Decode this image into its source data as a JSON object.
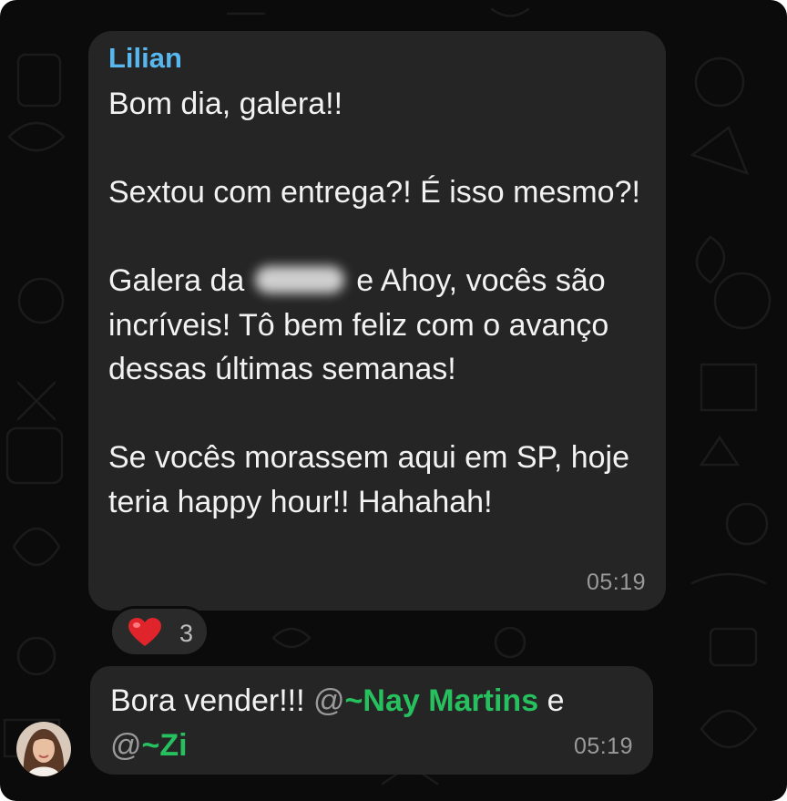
{
  "message1": {
    "sender": "Lilian",
    "line1": "Bom dia, galera!!",
    "line2": "Sextou com entrega?! É isso mesmo?!",
    "line3a": "Galera da",
    "line3b": "e Ahoy, vocês são incríveis! Tô bem feliz com o avanço dessas últimas semanas!",
    "line4": "Se vocês morassem aqui em SP, hoje teria happy hour!! Hahahah!",
    "time": "05:19",
    "reaction": {
      "emoji": "heart",
      "count": "3"
    }
  },
  "message2": {
    "text": "Bora vender!!!",
    "mention1_at": "@",
    "mention1_name": "~Nay Martins",
    "joiner": "e",
    "mention2_at": "@",
    "mention2_name": "~Zi",
    "time": "05:19"
  },
  "colors": {
    "background": "#0b0b0b",
    "bubble": "#252525",
    "sender": "#57b7ee",
    "mention": "#27c05f",
    "timestamp": "#9a9a9a"
  },
  "icons": [
    "heart-icon",
    "avatar"
  ]
}
